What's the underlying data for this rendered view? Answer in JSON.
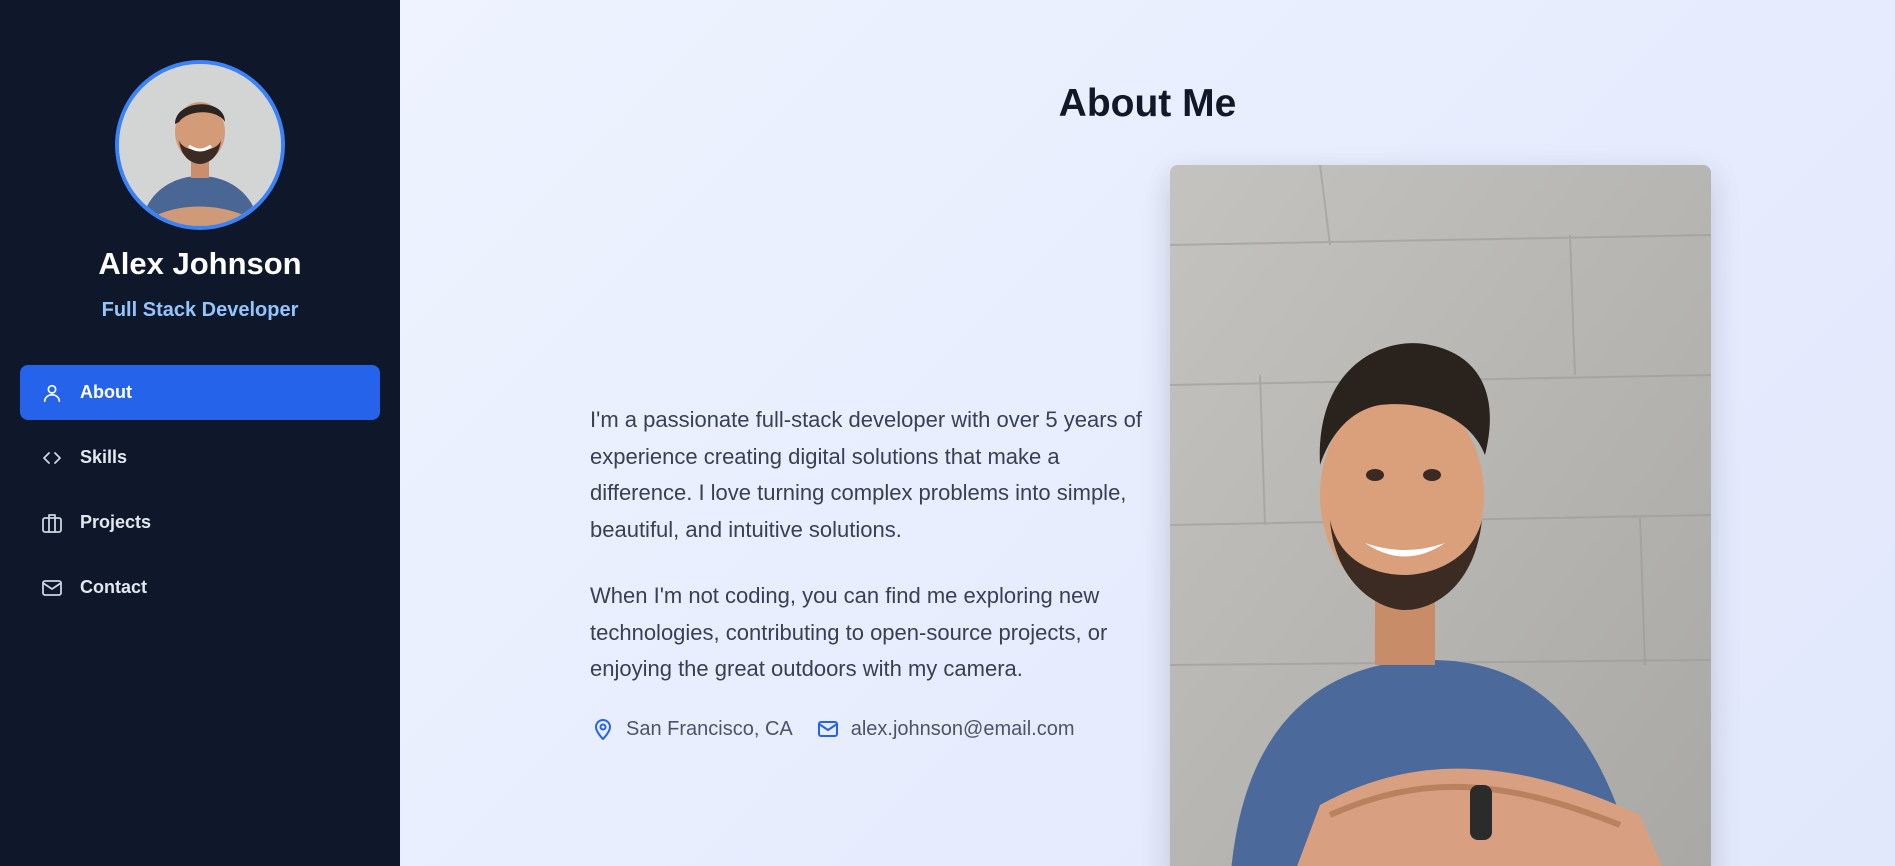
{
  "profile": {
    "name": "Alex Johnson",
    "role": "Full Stack Developer",
    "avatar_icon": "person-portrait"
  },
  "nav": {
    "items": [
      {
        "label": "About",
        "icon": "user-icon",
        "active": true
      },
      {
        "label": "Skills",
        "icon": "code-icon",
        "active": false
      },
      {
        "label": "Projects",
        "icon": "briefcase-icon",
        "active": false
      },
      {
        "label": "Contact",
        "icon": "mail-icon",
        "active": false
      }
    ]
  },
  "main": {
    "title": "About Me",
    "paragraphs": [
      "I'm a passionate full-stack developer with over 5 years of experience creating digital solutions that make a difference. I love turning complex problems into simple, beautiful, and intuitive solutions.",
      "When I'm not coding, you can find me exploring new technologies, contributing to open-source projects, or enjoying the great outdoors with my camera."
    ],
    "location": "San Francisco, CA",
    "email": "alex.johnson@email.com"
  },
  "colors": {
    "sidebar_bg": "#0f172a",
    "accent": "#2563eb",
    "role_text": "#93c5fd",
    "avatar_ring": "#3b82f6"
  }
}
